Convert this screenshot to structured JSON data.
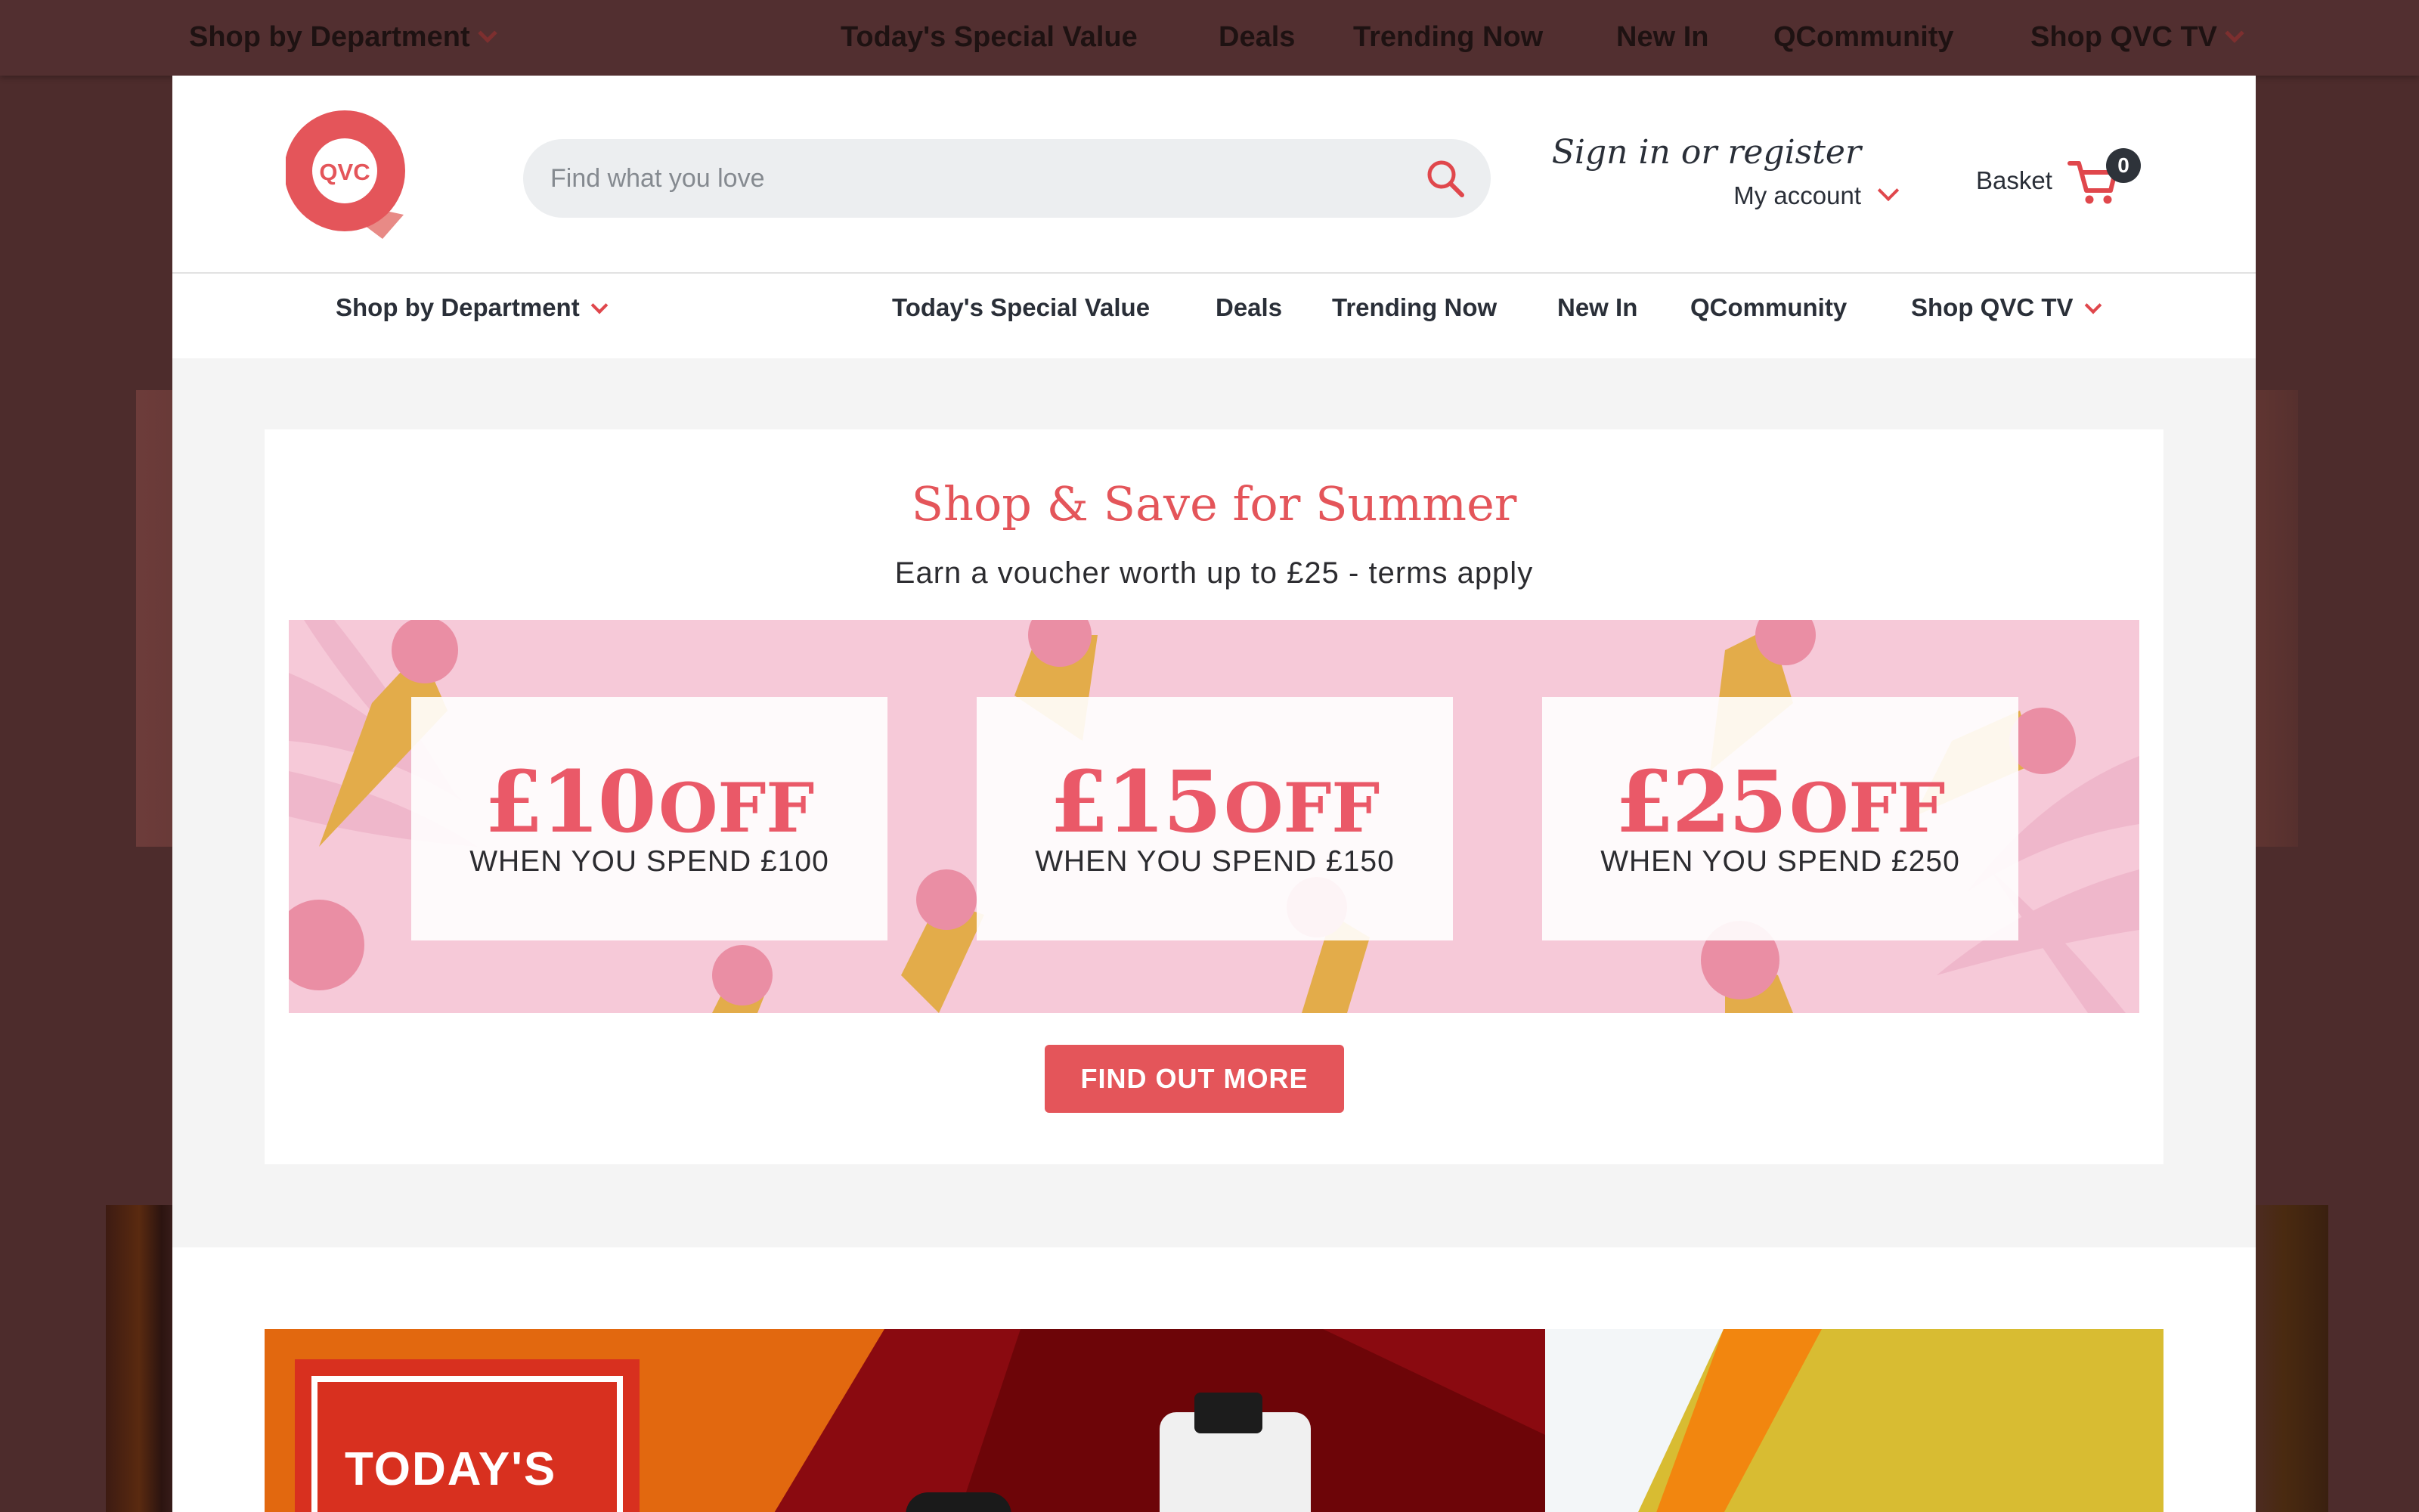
{
  "background_nav": {
    "department": "Shop by Department",
    "links": [
      "Today's Special Value",
      "Deals",
      "Trending Now",
      "New In",
      "QCommunity",
      "Shop QVC TV"
    ]
  },
  "header": {
    "logo_text": "QVC",
    "search_placeholder": "Find what you love",
    "sign_in": "Sign in or register",
    "my_account": "My account",
    "basket_label": "Basket",
    "basket_count": "0"
  },
  "nav": {
    "department": "Shop by Department",
    "links": [
      "Today's Special Value",
      "Deals",
      "Trending Now",
      "New In",
      "QCommunity",
      "Shop QVC TV"
    ]
  },
  "promo": {
    "title": "Shop & Save for Summer",
    "subtitle": "Earn a voucher worth up to £25 - terms apply",
    "offers": [
      {
        "amount": "£10",
        "off": "OFF",
        "condition": "WHEN YOU SPEND £100"
      },
      {
        "amount": "£15",
        "off": "OFF",
        "condition": "WHEN YOU SPEND £150"
      },
      {
        "amount": "£25",
        "off": "OFF",
        "condition": "WHEN YOU SPEND £250"
      }
    ],
    "cta": "FIND OUT MORE"
  },
  "tsv": {
    "badge": "TODAY'S"
  },
  "colors": {
    "brand": "#e4555a",
    "dim_background": "#4d2c2c",
    "banner_pink": "#f6c9d8"
  }
}
